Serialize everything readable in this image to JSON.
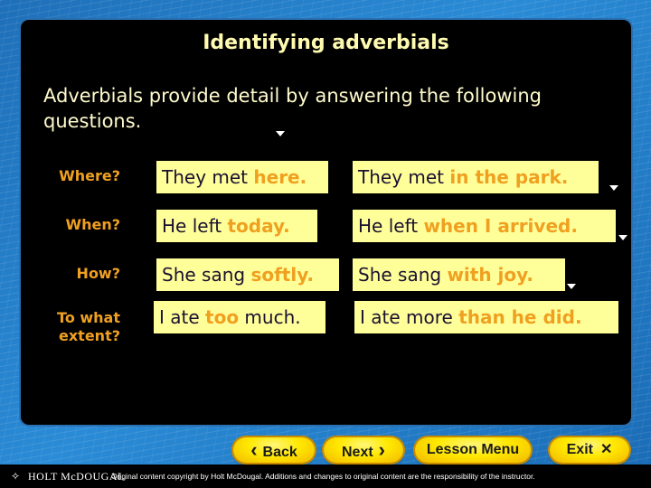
{
  "slide": {
    "title": "Identifying adverbials",
    "intro": "Adverbials provide detail by answering the following questions."
  },
  "rows": [
    {
      "question": "Where?",
      "example_1": {
        "plain": "They met ",
        "adverbial": "here.",
        "after": ""
      },
      "example_2": {
        "plain": "They met ",
        "adverbial": "in the park.",
        "after": ""
      }
    },
    {
      "question": "When?",
      "example_1": {
        "plain": "He left ",
        "adverbial": "today.",
        "after": ""
      },
      "example_2": {
        "plain": "He left ",
        "adverbial": "when I arrived.",
        "after": ""
      }
    },
    {
      "question": "How?",
      "example_1": {
        "plain": "She sang ",
        "adverbial": "softly.",
        "after": ""
      },
      "example_2": {
        "plain": "She sang ",
        "adverbial": "with joy.",
        "after": ""
      }
    },
    {
      "question": "To what extent?",
      "question_line1": "To what",
      "question_line2": "extent?",
      "example_1": {
        "plain": "I ate ",
        "adverbial": "too",
        "after": " much."
      },
      "example_2": {
        "plain": "I ate more ",
        "adverbial": "than he did.",
        "after": ""
      }
    }
  ],
  "navigation": {
    "back": "Back",
    "next": "Next",
    "lesson_menu": "Lesson Menu",
    "exit": "Exit",
    "back_icon": "‹",
    "next_icon": "›",
    "exit_icon": "✕"
  },
  "footer": {
    "brand": "HOLT McDOUGAL",
    "copyright": "Original content copyright by Holt McDougal. Additions and changes to original content are the responsibility of the instructor."
  },
  "colors": {
    "panel": "#000000",
    "title": "#fffbb0",
    "question": "#f0a020",
    "example_box": "#ffff99",
    "adverbial": "#f0a020",
    "button": "#ffe800"
  }
}
